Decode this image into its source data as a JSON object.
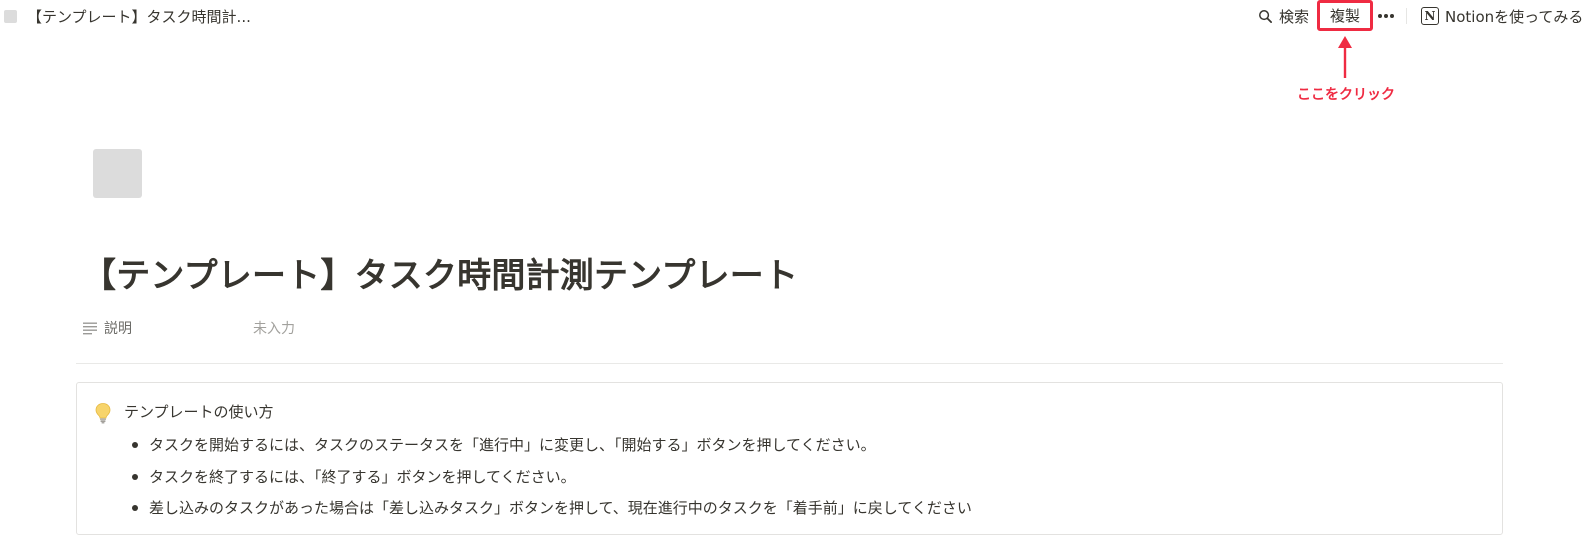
{
  "topbar": {
    "breadcrumb_title": "【テンプレート】タスク時間計...",
    "search_label": "検索",
    "duplicate_label": "複製",
    "try_notion_label": "Notionを使ってみる"
  },
  "annotation": {
    "text": "ここをクリック",
    "color": "#ef2b42"
  },
  "page": {
    "title": "【テンプレート】タスク時間計測テンプレート",
    "property": {
      "name": "説明",
      "value": "未入力"
    }
  },
  "callout": {
    "icon": "lightbulb-icon",
    "title": "テンプレートの使い方",
    "items": [
      "タスクを開始するには、タスクのステータスを「進行中」に変更し、「開始する」ボタンを押してください。",
      "タスクを終了するには、「終了する」ボタンを押してください。",
      "差し込みのタスクがあった場合は「差し込みタスク」ボタンを押して、現在進行中のタスクを「着手前」に戻してください"
    ]
  }
}
